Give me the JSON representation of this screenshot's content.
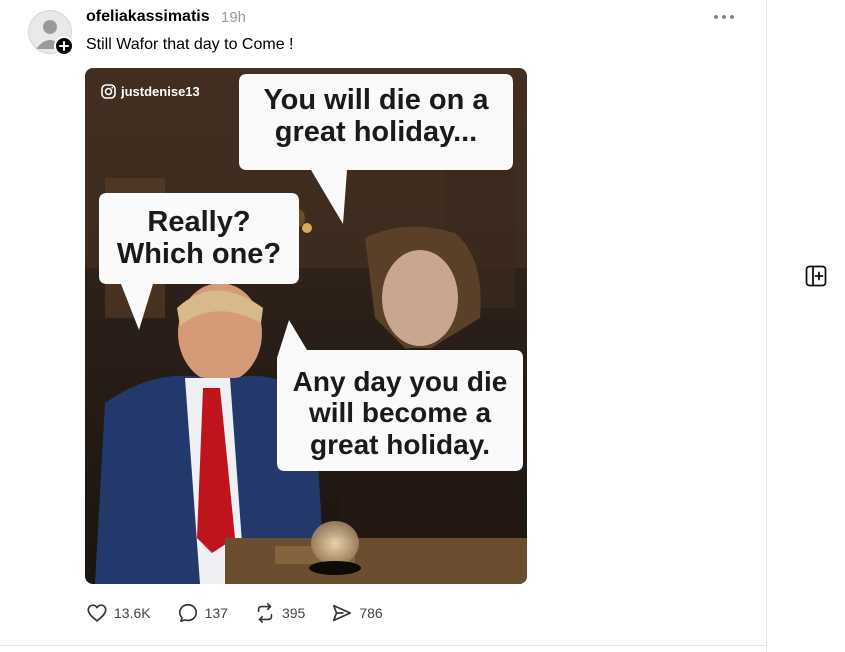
{
  "post": {
    "username": "ofeliakassimatis",
    "time": "19h",
    "text": "Still Wafor that day to Come !",
    "media": {
      "watermark": "justdenise13",
      "bubble_top": "You will die on a great holiday...",
      "bubble_left": "Really? Which one?",
      "bubble_bottom": "Any day you die will become a great holiday."
    },
    "stats": {
      "likes": "13.6K",
      "replies": "137",
      "reposts": "395",
      "shares": "786"
    }
  },
  "icons": {
    "like": "heart-icon",
    "reply": "comment-icon",
    "repost": "repost-icon",
    "share": "send-icon",
    "more": "more-dots-icon",
    "side": "add-column-icon"
  }
}
